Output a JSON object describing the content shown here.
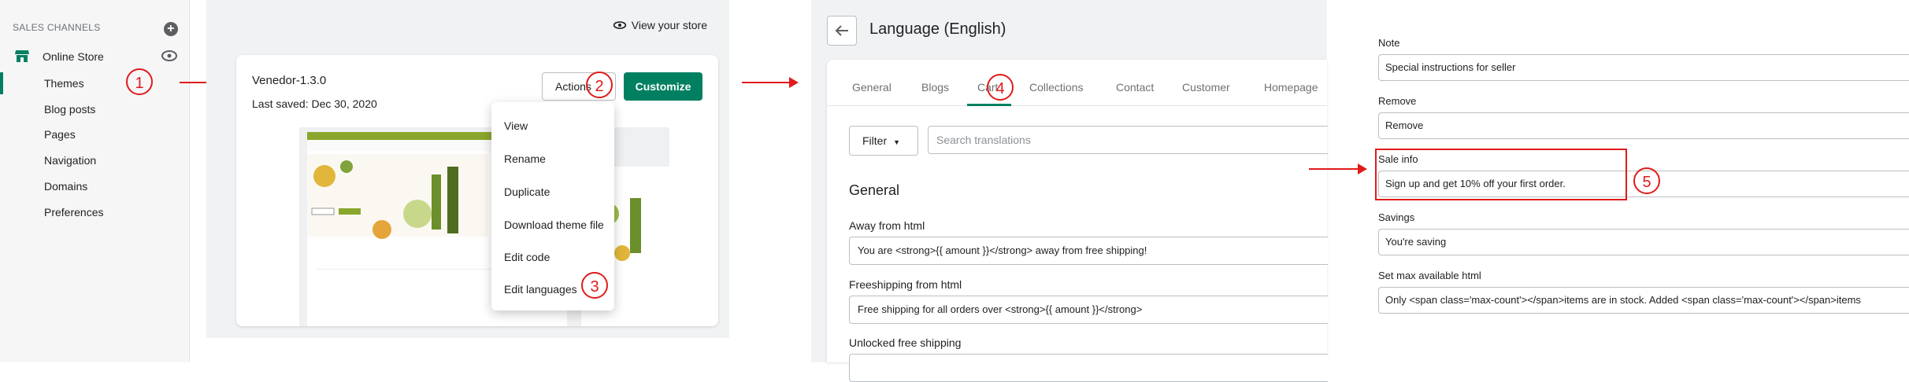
{
  "sidebar": {
    "section_title": "SALES CHANNELS",
    "add_symbol": "+",
    "channel": "Online Store",
    "items": [
      "Themes",
      "Blog posts",
      "Pages",
      "Navigation",
      "Domains",
      "Preferences"
    ]
  },
  "themes": {
    "view_store": "View your store",
    "theme_name": "Venedor-1.3.0",
    "last_saved": "Last saved: Dec 30, 2020",
    "actions_label": "Actions",
    "customize_label": "Customize",
    "menu": [
      "View",
      "Rename",
      "Duplicate",
      "Download theme file",
      "Edit code",
      "Edit languages"
    ]
  },
  "language": {
    "title": "Language (English)",
    "tabs": [
      "General",
      "Blogs",
      "Cart",
      "Collections",
      "Contact",
      "Customer",
      "Homepage"
    ],
    "filter_label": "Filter",
    "search_placeholder": "Search translations",
    "section": "General",
    "fields": [
      {
        "label": "Away from html",
        "value": "You are <strong>{{ amount }}</strong> away from free shipping!"
      },
      {
        "label": "Freeshipping from html",
        "value": "Free shipping for all orders over <strong>{{ amount }}</strong>"
      },
      {
        "label": "Unlocked free shipping",
        "value": ""
      }
    ]
  },
  "translations": [
    {
      "label": "Note",
      "value": "Special instructions for seller"
    },
    {
      "label": "Remove",
      "value": "Remove"
    },
    {
      "label": "Sale info",
      "value": "Sign up and get 10% off your first order."
    },
    {
      "label": "Savings",
      "value": "You're saving"
    },
    {
      "label": "Set max available html",
      "value": "Only <span class='max-count'></span>items are in stock. Added <span class='max-count'></span>items"
    }
  ],
  "annotations": [
    "1",
    "2",
    "3",
    "4",
    "5"
  ],
  "colors": {
    "accent": "#008060",
    "annotation": "#e01b1b",
    "sidebar_bg": "#f6f6f7"
  }
}
